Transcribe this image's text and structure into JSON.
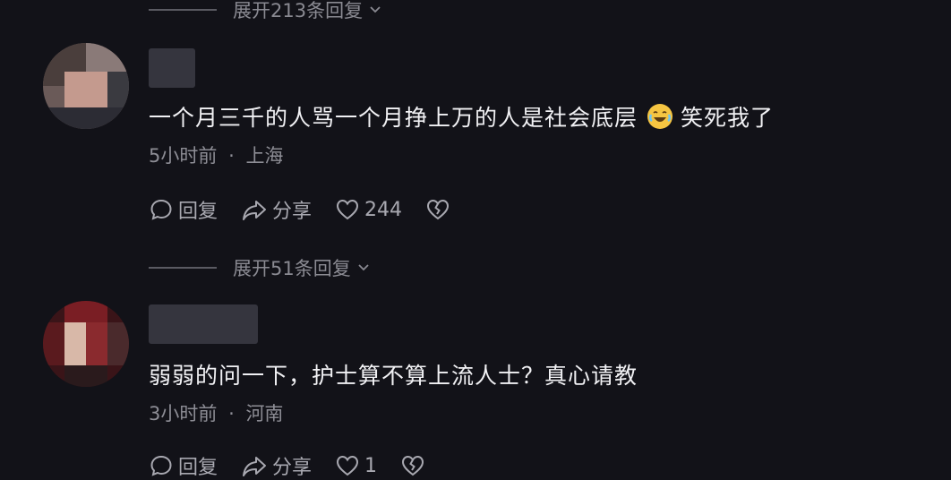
{
  "top_expand": {
    "label": "展开213条回复"
  },
  "comments": [
    {
      "text_before_emoji": "一个月三千的人骂一个月挣上万的人是社会底层",
      "emoji": "laughing-tears-icon",
      "text_after_emoji": "笑死我了",
      "time": "5小时前",
      "separator": "·",
      "location": "上海",
      "reply_label": "回复",
      "share_label": "分享",
      "like_count": "244"
    },
    {
      "text": "弱弱的问一下，护士算不算上流人士？真心请教",
      "time": "3小时前",
      "separator": "·",
      "location": "河南",
      "reply_label": "回复",
      "share_label": "分享",
      "like_count": "1"
    }
  ],
  "mid_expand": {
    "label": "展开51条回复"
  },
  "colors": {
    "background": "#121218",
    "text": "#f1f1f4",
    "muted": "#8d8d95"
  }
}
